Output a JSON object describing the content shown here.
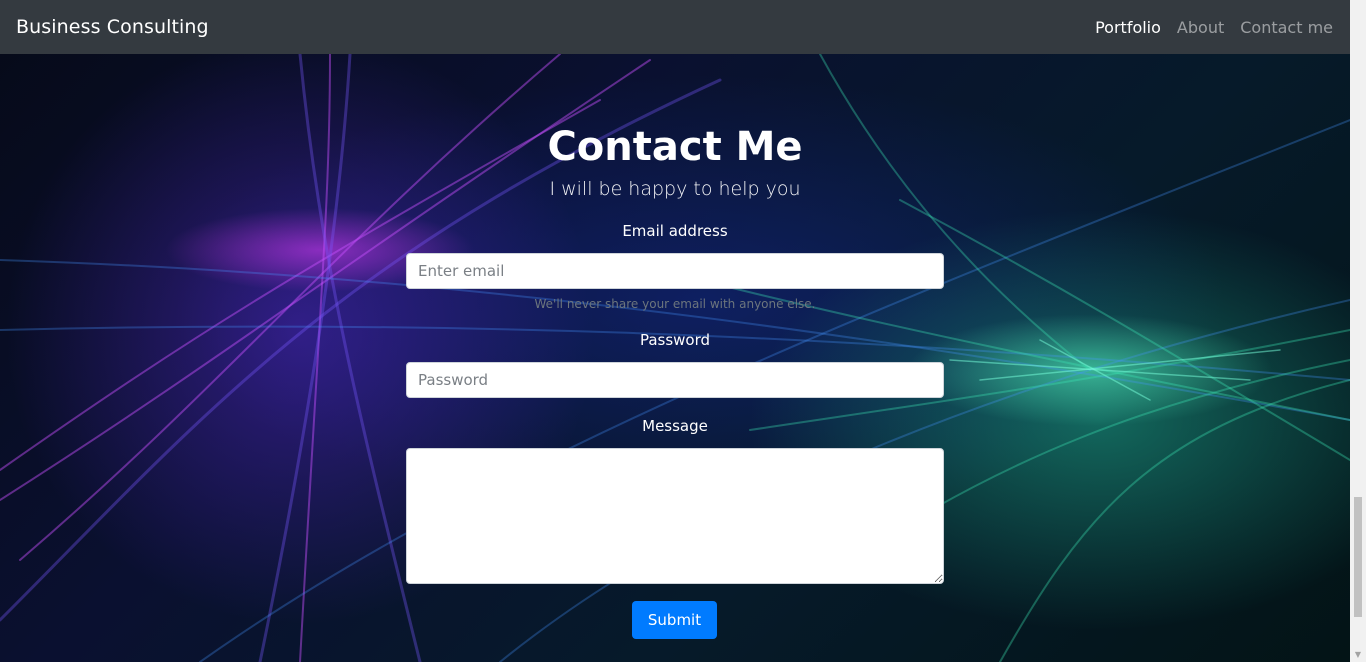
{
  "navbar": {
    "brand": "Business Consulting",
    "links": [
      {
        "label": "Portfolio",
        "active": true
      },
      {
        "label": "About",
        "active": false
      },
      {
        "label": "Contact me",
        "active": false
      }
    ]
  },
  "contact": {
    "title": "Contact Me",
    "subtitle": "I will be happy to help you",
    "email": {
      "label": "Email address",
      "placeholder": "Enter email",
      "value": "",
      "help": "We'll never share your email with anyone else."
    },
    "password": {
      "label": "Password",
      "placeholder": "Password",
      "value": ""
    },
    "message": {
      "label": "Message",
      "value": ""
    },
    "submit_label": "Submit"
  },
  "colors": {
    "navbar_bg": "#343a40",
    "primary": "#007bff",
    "text_white": "#ffffff",
    "muted": "#6c757d"
  },
  "icons": {
    "scroll_down": "chevron-down-icon"
  }
}
